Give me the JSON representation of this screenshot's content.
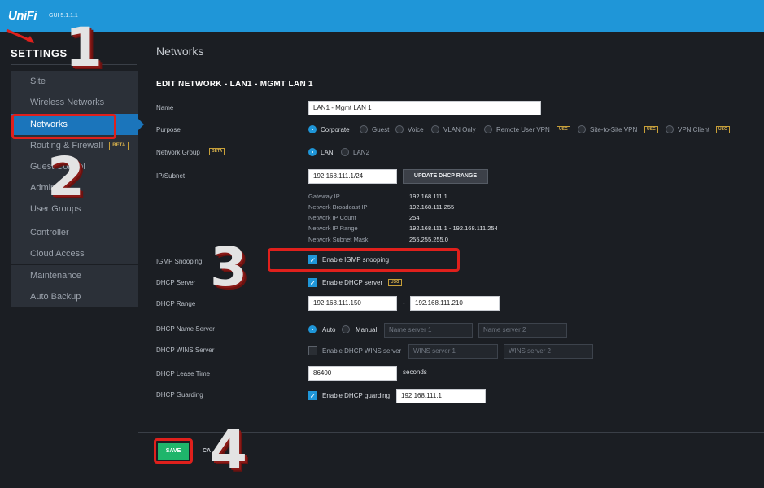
{
  "app": {
    "logo": "UniFi",
    "version": "GUI 5.1.1.1"
  },
  "sidebar": {
    "title": "SETTINGS",
    "items": [
      {
        "label": "Site"
      },
      {
        "label": "Wireless Networks"
      },
      {
        "label": "Networks",
        "active": true
      },
      {
        "label": "Routing & Firewall",
        "badge": "BETA"
      },
      {
        "label": "Guest Control"
      },
      {
        "label": "Admins"
      },
      {
        "label": "User Groups"
      }
    ],
    "lower_items": [
      {
        "label": "Controller"
      },
      {
        "label": "Cloud Access"
      },
      {
        "label": "Maintenance"
      },
      {
        "label": "Auto Backup"
      }
    ]
  },
  "main": {
    "title": "Networks",
    "edit_title": "EDIT NETWORK - LAN1 - MGMT LAN 1",
    "labels": {
      "name": "Name",
      "purpose": "Purpose",
      "network_group": "Network Group",
      "ip_subnet": "IP/Subnet",
      "igmp": "IGMP Snooping",
      "dhcp_server": "DHCP Server",
      "dhcp_range": "DHCP Range",
      "dhcp_name_server": "DHCP Name Server",
      "dhcp_wins": "DHCP WINS Server",
      "dhcp_lease": "DHCP Lease Time",
      "dhcp_guarding": "DHCP Guarding"
    },
    "name_value": "LAN1 - Mgmt LAN 1",
    "network_group_badge": "BETA",
    "purpose_options": [
      {
        "label": "Corporate",
        "selected": true
      },
      {
        "label": "Guest"
      },
      {
        "label": "Voice"
      },
      {
        "label": "VLAN Only"
      },
      {
        "label": "Remote User VPN",
        "badge": "USG"
      },
      {
        "label": "Site-to-Site VPN",
        "badge": "USG"
      },
      {
        "label": "VPN Client",
        "badge": "USG"
      }
    ],
    "group_options": [
      {
        "label": "LAN",
        "selected": true
      },
      {
        "label": "LAN2"
      }
    ],
    "ip_subnet": "192.168.111.1/24",
    "update_dhcp_button": "UPDATE DHCP RANGE",
    "subnet_info": [
      {
        "key": "Gateway IP",
        "value": "192.168.111.1"
      },
      {
        "key": "Network Broadcast IP",
        "value": "192.168.111.255"
      },
      {
        "key": "Network IP Count",
        "value": "254"
      },
      {
        "key": "Network IP Range",
        "value": "192.168.111.1 - 192.168.111.254"
      },
      {
        "key": "Network Subnet Mask",
        "value": "255.255.255.0"
      }
    ],
    "igmp_checkbox": "Enable IGMP snooping",
    "dhcp_server_checkbox": "Enable DHCP server",
    "dhcp_server_badge": "USG",
    "dhcp_range_start": "192.168.111.150",
    "dhcp_range_sep": "-",
    "dhcp_range_end": "192.168.111.210",
    "name_server_auto": "Auto",
    "name_server_manual": "Manual",
    "name_server_1_placeholder": "Name server 1",
    "name_server_2_placeholder": "Name server 2",
    "wins_checkbox": "Enable DHCP WINS server",
    "wins_1_placeholder": "WINS server 1",
    "wins_2_placeholder": "WINS server 2",
    "lease_time": "86400",
    "lease_unit": "seconds",
    "guarding_checkbox": "Enable DHCP guarding",
    "guarding_ip": "192.168.111.1",
    "save_button": "SAVE",
    "cancel_button": "CA"
  },
  "annotations": {
    "step1": "1",
    "step2": "2",
    "step3": "3",
    "step4": "4"
  },
  "colors": {
    "topbar": "#1f96d8",
    "active_nav": "#1b75bb",
    "save": "#1fb56b",
    "highlight": "#e0201c"
  }
}
